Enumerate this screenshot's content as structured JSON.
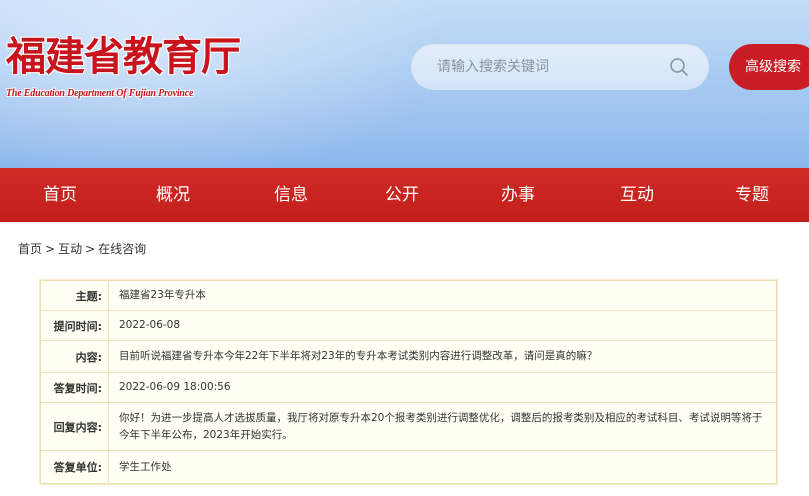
{
  "header": {
    "title": "福建省教育厅",
    "subtitle": "The Education Department Of Fujian Province",
    "search_placeholder": "请输入搜索关键词",
    "advanced_search_label": "高级搜索",
    "accent_color": "#c81d25"
  },
  "nav": {
    "items": [
      {
        "label": "首页"
      },
      {
        "label": "概况"
      },
      {
        "label": "信息"
      },
      {
        "label": "公开"
      },
      {
        "label": "办事"
      },
      {
        "label": "互动"
      },
      {
        "label": "专题"
      }
    ]
  },
  "breadcrumb": {
    "items": [
      "首页",
      "互动",
      "在线咨询"
    ],
    "separator": ">"
  },
  "detail": {
    "rows": [
      {
        "label": "主题:",
        "value": "福建省23年专升本"
      },
      {
        "label": "提问时间:",
        "value": "2022-06-08"
      },
      {
        "label": "内容:",
        "value": "目前听说福建省专升本今年22年下半年将对23年的专升本考试类别内容进行调整改革，请问是真的嘛？"
      },
      {
        "label": "答复时间:",
        "value": "2022-06-09 18:00:56"
      },
      {
        "label": "回复内容:",
        "value": "你好！为进一步提高人才选拔质量，我厅将对原专升本20个报考类别进行调整优化，调整后的报考类别及相应的考试科目、考试说明等将于今年下半年公布，2023年开始实行。"
      },
      {
        "label": "答复单位:",
        "value": "学生工作处"
      }
    ]
  },
  "icons": {
    "search": "search-icon"
  }
}
